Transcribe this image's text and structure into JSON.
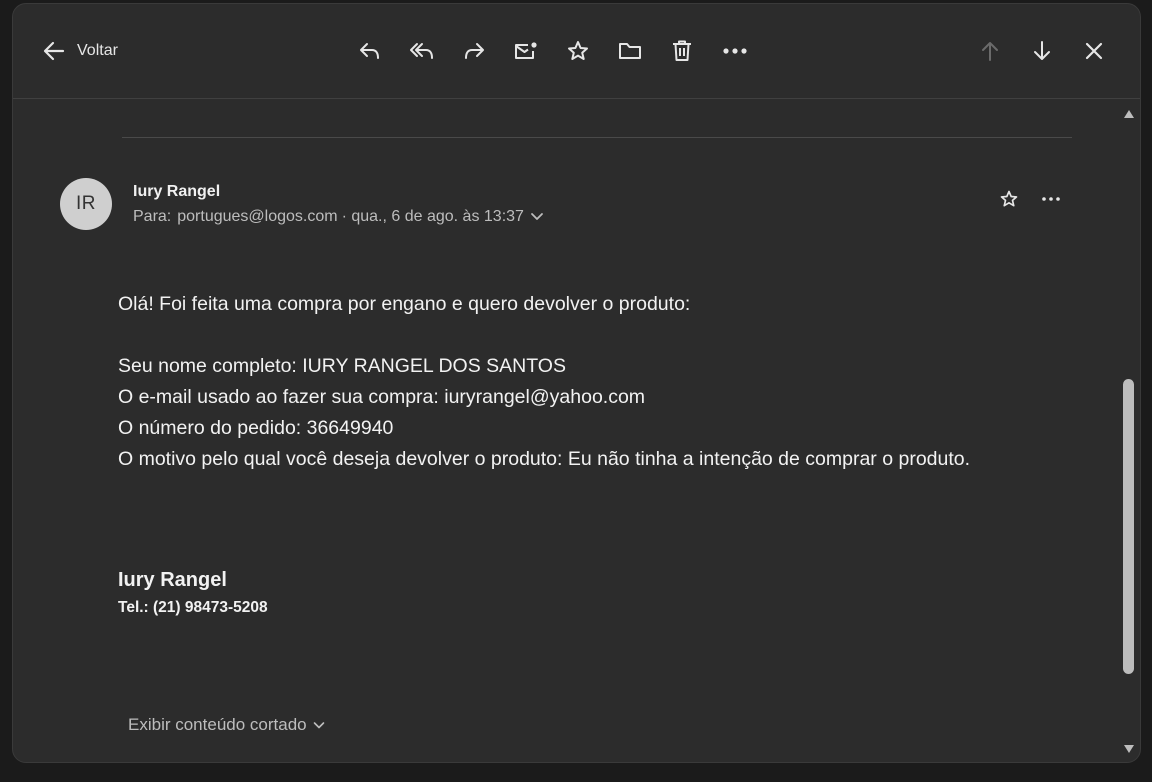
{
  "toolbar": {
    "back_label": "Voltar",
    "icons": [
      "reply-icon",
      "reply-all-icon",
      "forward-icon",
      "mark-unread-icon",
      "star-icon",
      "folder-icon",
      "trash-icon",
      "more-icon",
      "arrow-up-icon",
      "arrow-down-icon",
      "close-icon"
    ]
  },
  "message": {
    "avatar_initials": "IR",
    "sender": "Iury Rangel",
    "to_label": "Para:",
    "to_address": "portugues@logos.com",
    "date": "· qua., 6 de ago. às 13:37",
    "body": {
      "greeting": "Olá! Foi feita uma compra por engano e quero devolver o produto:",
      "lines": [
        "Seu nome completo: IURY RANGEL DOS SANTOS",
        "O e-mail usado ao fazer sua compra: iuryrangel@yahoo.com",
        "O número do pedido: 36649940",
        "O motivo pelo qual você deseja devolver o produto: Eu não tinha a intenção de comprar o produto."
      ]
    },
    "signature": {
      "name": "Iury Rangel",
      "phone": "Tel.: (21) 98473-5208"
    },
    "show_trimmed_label": "Exibir conteúdo cortado"
  },
  "colors": {
    "background": "#2c2c2c",
    "outer": "#1b1b1b",
    "text": "#f2f2f2",
    "muted": "#bdbdbd",
    "disabled": "#6b6b6b"
  }
}
